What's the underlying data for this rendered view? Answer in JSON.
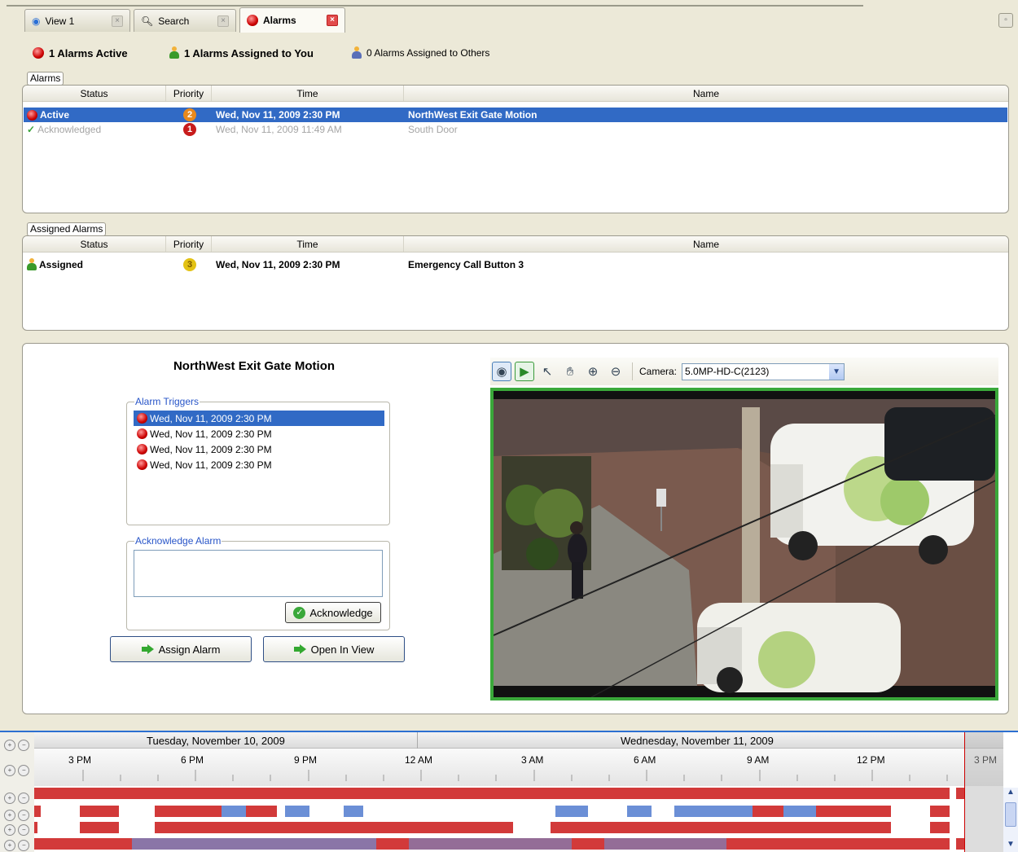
{
  "tabs": [
    {
      "label": "View 1",
      "icon": "eye-icon"
    },
    {
      "label": "Search",
      "icon": "search-icon"
    },
    {
      "label": "Alarms",
      "icon": "alarm-icon",
      "active": true
    }
  ],
  "summary": {
    "active": "1 Alarms Active",
    "assigned_to_you": "1 Alarms Assigned to You",
    "assigned_to_others": "0 Alarms Assigned to Others"
  },
  "alarms_panel": {
    "title": "Alarms",
    "columns": [
      "Status",
      "Priority",
      "Time",
      "Name"
    ],
    "rows": [
      {
        "status": "Active",
        "priority": "2",
        "time": "Wed, Nov 11, 2009 2:30 PM",
        "name": "NorthWest Exit Gate Motion",
        "selected": true
      },
      {
        "status": "Acknowledged",
        "priority": "1",
        "time": "Wed, Nov 11, 2009 11:49 AM",
        "name": "South Door",
        "selected": false
      }
    ]
  },
  "assigned_panel": {
    "title": "Assigned Alarms",
    "columns": [
      "Status",
      "Priority",
      "Time",
      "Name"
    ],
    "rows": [
      {
        "status": "Assigned",
        "priority": "3",
        "time": "Wed, Nov 11, 2009 2:30 PM",
        "name": "Emergency Call Button 3"
      }
    ]
  },
  "detail": {
    "title": "NorthWest Exit Gate Motion",
    "triggers_legend": "Alarm Triggers",
    "triggers": [
      "Wed, Nov 11, 2009 2:30 PM",
      "Wed, Nov 11, 2009 2:30 PM",
      "Wed, Nov 11, 2009 2:30 PM",
      "Wed, Nov 11, 2009 2:30 PM"
    ],
    "ack_legend": "Acknowledge Alarm",
    "ack_note": "",
    "ack_button": "Acknowledge",
    "assign_button": "Assign Alarm",
    "open_button": "Open In View"
  },
  "camera": {
    "label": "Camera:",
    "selected": "5.0MP-HD-C(2123)"
  },
  "timeline": {
    "day1": "Tuesday, November 10, 2009",
    "day2": "Wednesday, November 11, 2009",
    "hours": [
      "3 PM",
      "6 PM",
      "9 PM",
      "12 AM",
      "3 AM",
      "6 AM",
      "9 AM",
      "12 PM",
      "3 PM"
    ]
  },
  "colors": {
    "selection": "#316ac5",
    "recording": "#d23a3a",
    "motion": "#6b8fd6",
    "camera_border": "#3aa83a"
  }
}
